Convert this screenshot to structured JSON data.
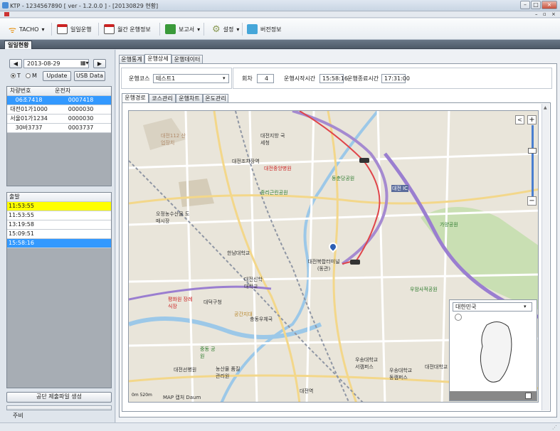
{
  "window": {
    "title": "KTP - 1234567890 [ ver - 1.2.0.0 ] - [20130829  현황]"
  },
  "toolbar": {
    "tacho": "TACHO",
    "daily": "일일운행",
    "monthly": "월간 운행정보",
    "report": "보고서",
    "settings": "설정",
    "version": "버전정보"
  },
  "doc_tab": "일일현황",
  "left": {
    "date": "2013-08-29",
    "radio_t": "T",
    "radio_m": "M",
    "update": "Update",
    "usb": "USB Data",
    "vehicle_headers": [
      "차량번호",
      "운전자"
    ],
    "vehicles": [
      {
        "plate": "06조7418",
        "driver": "0007418"
      },
      {
        "plate": "대전01가1000",
        "driver": "0000030"
      },
      {
        "plate": "서울01가1234",
        "driver": "0000030"
      },
      {
        "plate": "30바3737",
        "driver": "0003737"
      }
    ],
    "depart_header": "출발",
    "times": [
      "11:53:55",
      "11:53:55",
      "13:19:58",
      "15:09:51",
      "15:58:16"
    ],
    "gen_button": "공단 제출파일 생성",
    "bottom_label": "주비"
  },
  "main": {
    "tabs": [
      "운행통계",
      "운행상세",
      "운행데이터"
    ],
    "course_label": "운행코스",
    "course_value": "테스트1",
    "count_label": "회차",
    "count_value": "4",
    "start_label": "운행시작시간",
    "start_value": "15:58:16",
    "end_label": "운행종료시간",
    "end_value": "17:31:00",
    "subtabs": [
      "운행경로",
      "코스관리",
      "운행차트",
      "온도관리"
    ]
  },
  "map": {
    "labels": [
      "대전지방 국세청",
      "대전조차장역",
      "대전중앙병원",
      "동춘당공원",
      "중리근린공원",
      "오정농수산물 도매시장",
      "한남대학교",
      "대전복합터미널 (동관)",
      "대전신학 대학교",
      "가양공원",
      "대덕구청",
      "평화원 장례식장",
      "우암사적공원",
      "대전112 산업장치",
      "대전선병원",
      "우송대학교 서캠퍼스",
      "우송대학교 동캠퍼스",
      "대전대학교",
      "농산물 품질관리원",
      "대전역",
      "대전 IC",
      "공간지대",
      "충동우체국",
      "중동 공원"
    ],
    "scale_text": "0m    520m",
    "brand": "MAP 캡처 Daum",
    "minimap_select": "대한민국"
  }
}
